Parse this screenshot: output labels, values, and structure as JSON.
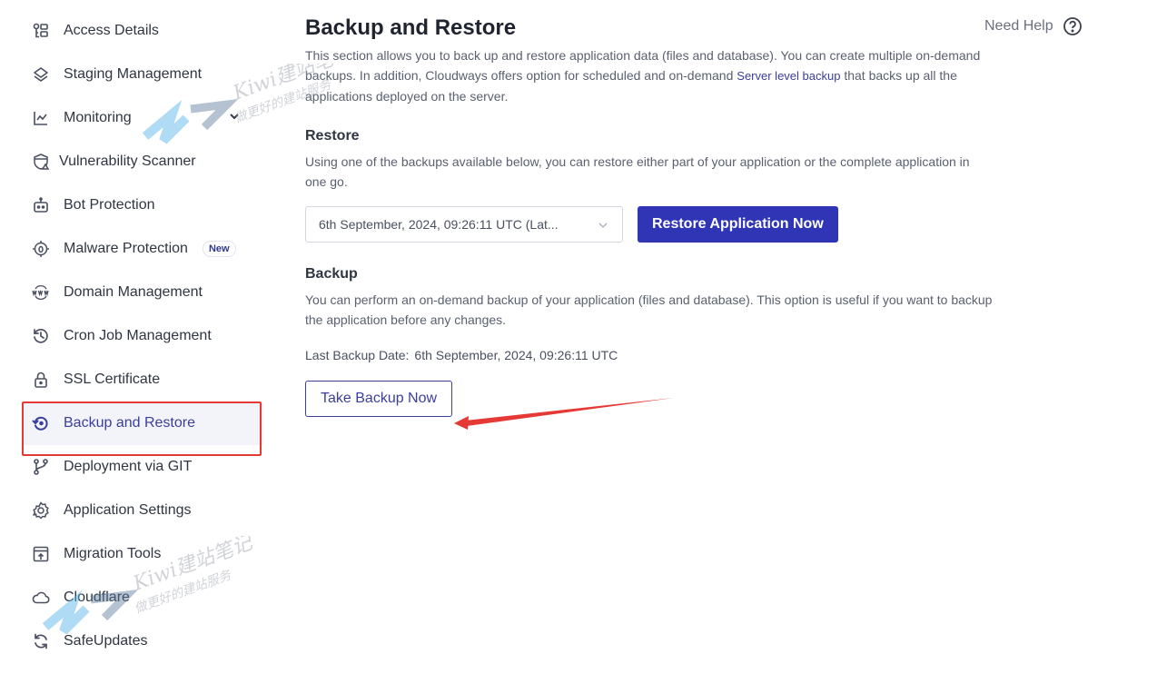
{
  "sidebar": {
    "items": [
      {
        "label": "Access Details",
        "icon": "access-details-icon"
      },
      {
        "label": "Staging Management",
        "icon": "layers-icon"
      },
      {
        "label": "Monitoring",
        "icon": "chart-line-icon",
        "expandable": true
      },
      {
        "label": "Vulnerability Scanner",
        "icon": "shield-warning-icon"
      },
      {
        "label": "Bot Protection",
        "icon": "robot-icon"
      },
      {
        "label": "Malware Protection",
        "icon": "bug-target-icon",
        "badge": "New"
      },
      {
        "label": "Domain Management",
        "icon": "www-globe-icon"
      },
      {
        "label": "Cron Job Management",
        "icon": "history-clock-icon"
      },
      {
        "label": "SSL Certificate",
        "icon": "lock-icon"
      },
      {
        "label": "Backup and Restore",
        "icon": "backup-restore-icon",
        "active": true
      },
      {
        "label": "Deployment via GIT",
        "icon": "git-branch-icon"
      },
      {
        "label": "Application Settings",
        "icon": "gear-icon"
      },
      {
        "label": "Migration Tools",
        "icon": "migration-upload-icon"
      },
      {
        "label": "Cloudflare",
        "icon": "cloud-icon"
      },
      {
        "label": "SafeUpdates",
        "icon": "refresh-icon"
      }
    ]
  },
  "header": {
    "title": "Backup and Restore",
    "help_label": "Need Help"
  },
  "intro": {
    "text_before_link": "This section allows you to back up and restore application data (files and database). You can create multiple on-demand backups. In addition, Cloudways offers option for scheduled and on-demand ",
    "link": "Server level backup",
    "text_after_link": " that backs up all the applications deployed on the server."
  },
  "restore": {
    "title": "Restore",
    "description": "Using one of the backups available below, you can restore either part of your application or the complete application in one go.",
    "selected_backup": "6th September, 2024, 09:26:11 UTC (Lat...",
    "button_label": "Restore Application Now"
  },
  "backup": {
    "title": "Backup",
    "description": "You can perform an on-demand backup of your application (files and database). This option is useful if you want to backup the application before any changes.",
    "last_backup_label": "Last Backup Date:",
    "last_backup_value": "6th September, 2024, 09:26:11 UTC",
    "button_label": "Take Backup Now"
  },
  "annotations": {
    "highlight_color": "#e53935",
    "watermark_text": "Kiwi建站笔记",
    "watermark_subtext": "做更好的建站服务"
  },
  "colors": {
    "primary": "#2f35b5",
    "accent_text": "#3b3f9a",
    "active_bg": "#f3f3fa"
  }
}
